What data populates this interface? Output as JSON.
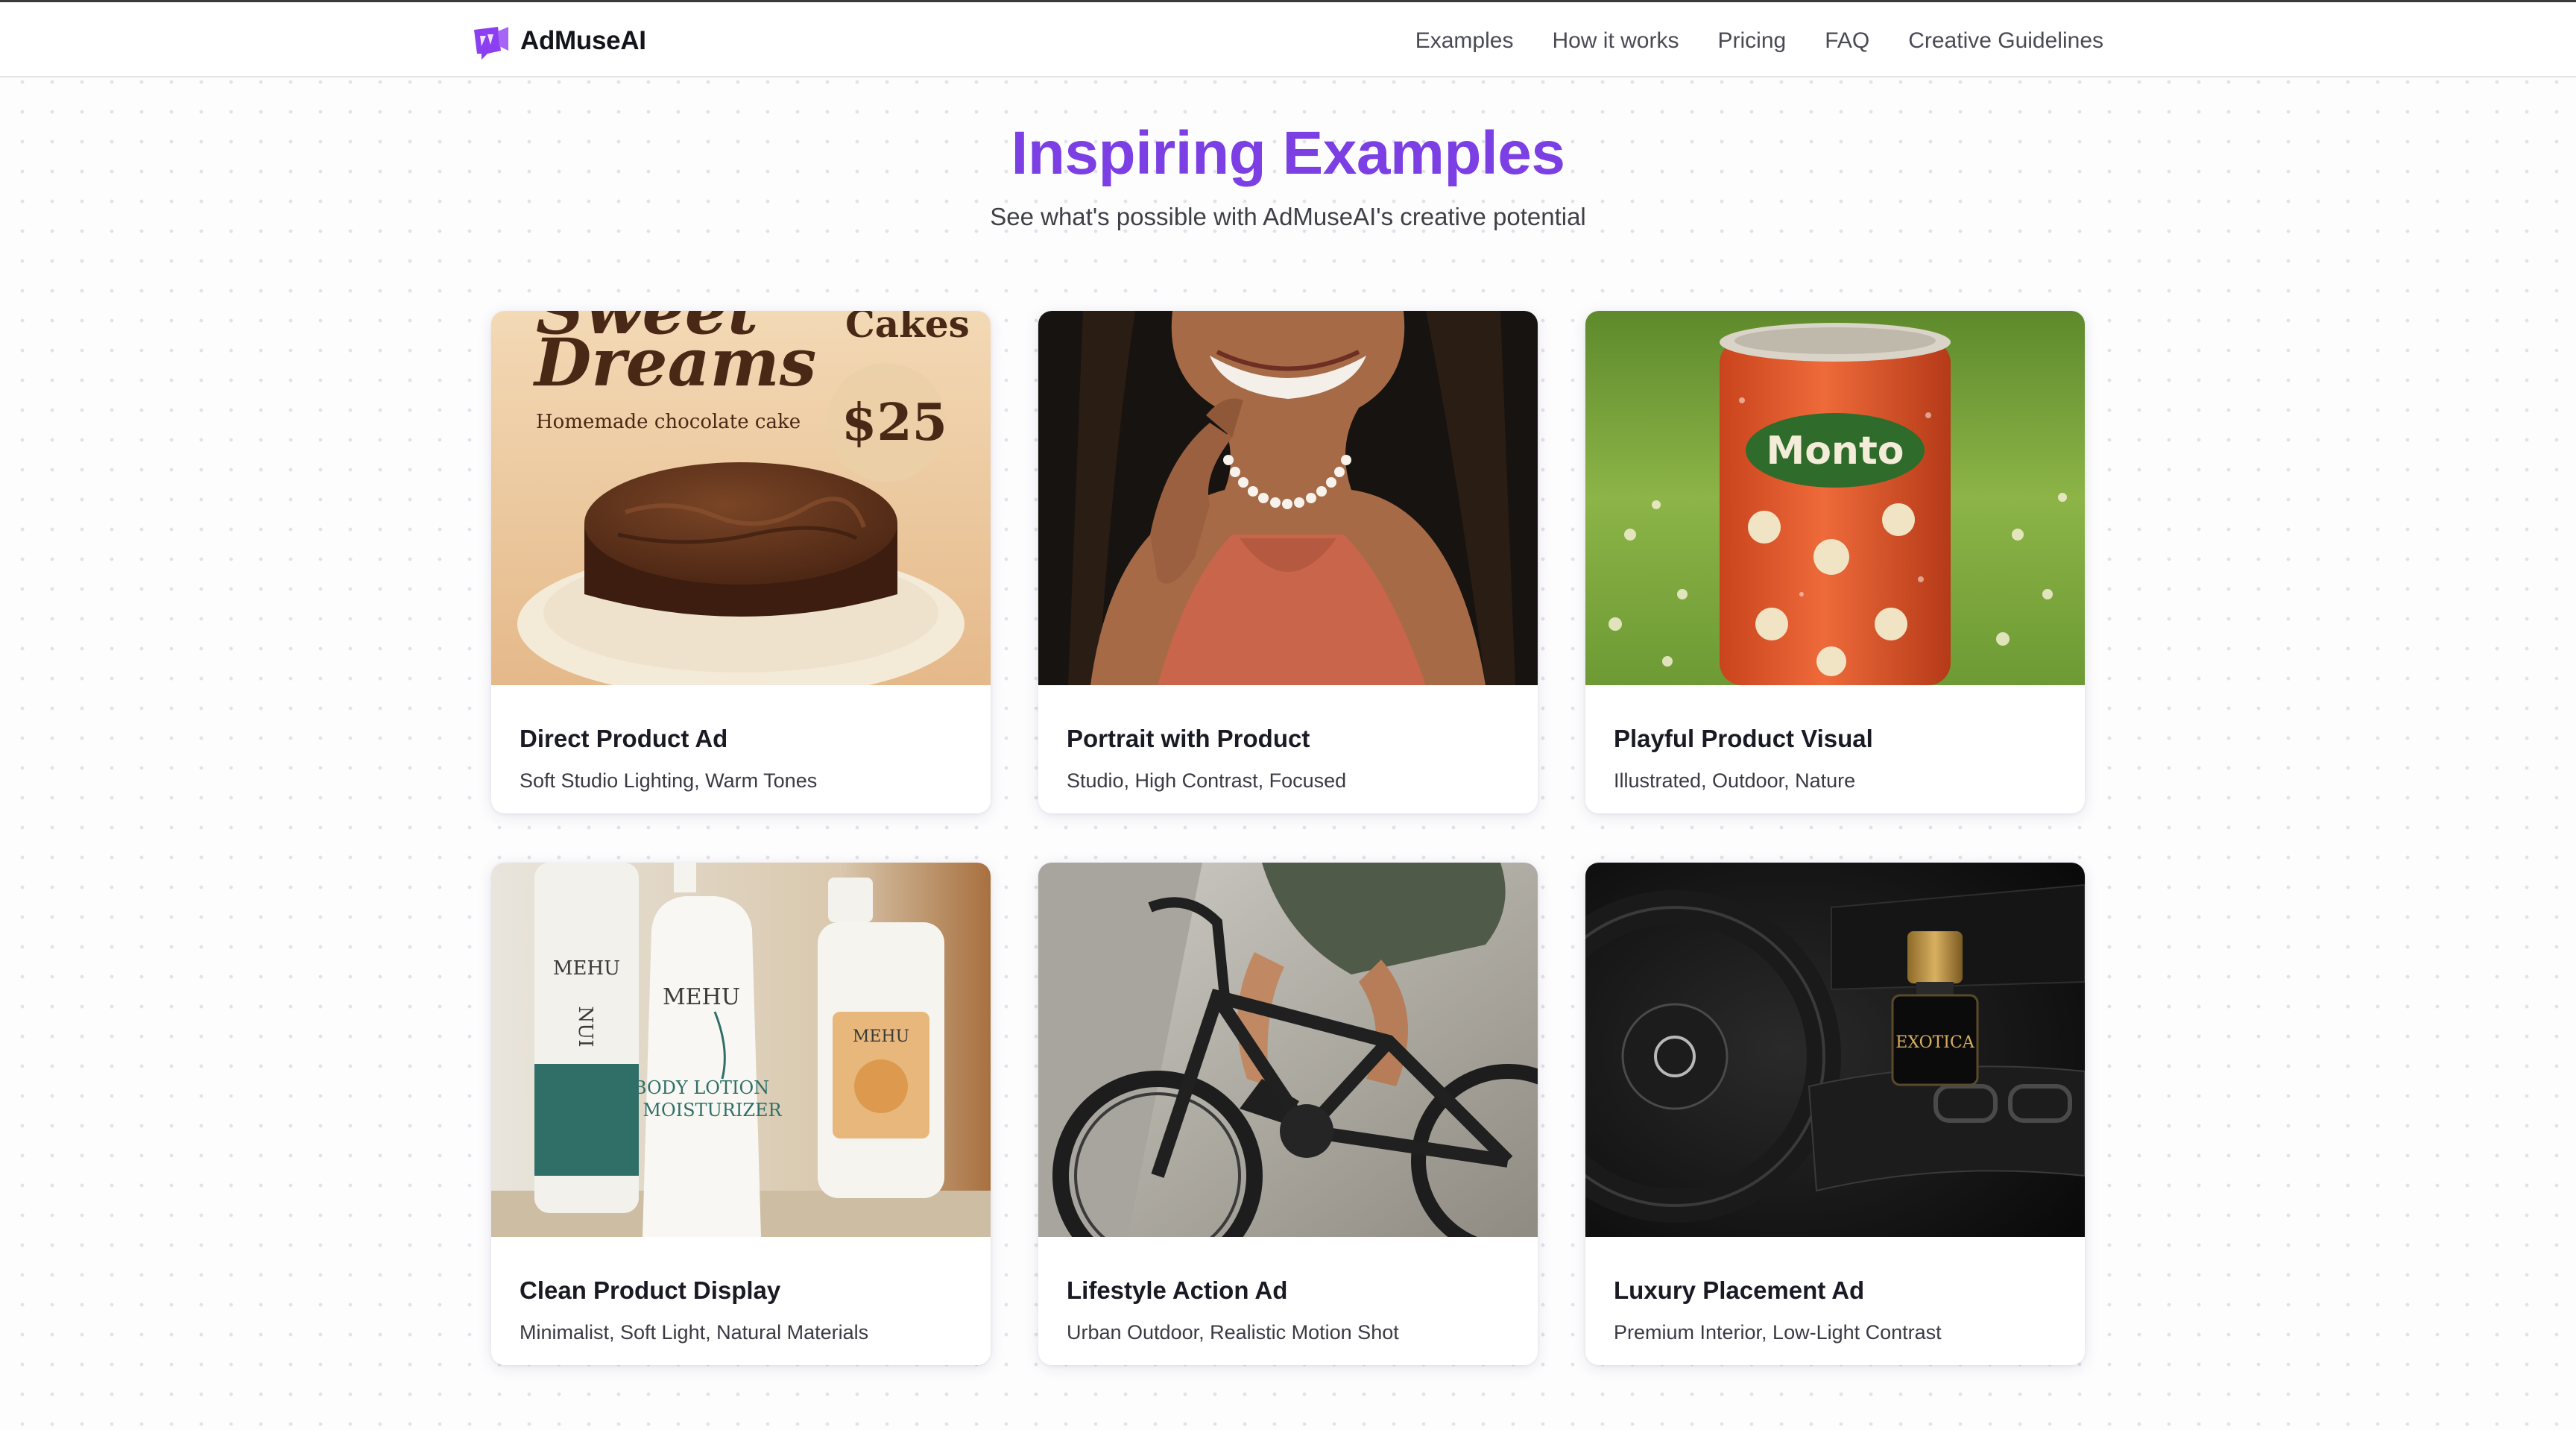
{
  "header": {
    "brand": "AdMuseAI",
    "nav": [
      "Examples",
      "How it works",
      "Pricing",
      "FAQ",
      "Creative Guidelines"
    ]
  },
  "hero": {
    "title": "Inspiring Examples",
    "subtitle": "See what's possible with AdMuseAI's creative potential"
  },
  "colors": {
    "accent": "#7b3fe4",
    "logo": "#8b3ff0",
    "text": "#1a1a24",
    "muted": "#3a3a44"
  },
  "cards": [
    {
      "title": "Direct Product Ad",
      "description": "Soft Studio Lighting, Warm Tones",
      "image": {
        "icon": "cake-ad-image",
        "text_top": "Sweet",
        "text_main": "Dreams",
        "text_corner": "Cakes",
        "tagline": "Homemade chocolate cake",
        "price": "$25"
      }
    },
    {
      "title": "Portrait with Product",
      "description": "Studio, High Contrast, Focused",
      "image": {
        "icon": "necklace-portrait-image"
      }
    },
    {
      "title": "Playful Product Visual",
      "description": "Illustrated, Outdoor, Nature",
      "image": {
        "icon": "soda-can-image",
        "brand": "Monto"
      }
    },
    {
      "title": "Clean Product Display",
      "description": "Minimalist, Soft Light, Natural Materials",
      "image": {
        "icon": "skincare-bottles-image",
        "brand": "MEHU",
        "product_line_1": "BODY LOTION",
        "product_line_2": "& MOISTURIZER",
        "left_label": "NUI"
      }
    },
    {
      "title": "Lifestyle Action Ad",
      "description": "Urban Outdoor, Realistic Motion Shot",
      "image": {
        "icon": "bicycle-image"
      }
    },
    {
      "title": "Luxury Placement Ad",
      "description": "Premium Interior, Low-Light Contrast",
      "image": {
        "icon": "car-perfume-image",
        "brand": "EXOTICA"
      }
    }
  ]
}
